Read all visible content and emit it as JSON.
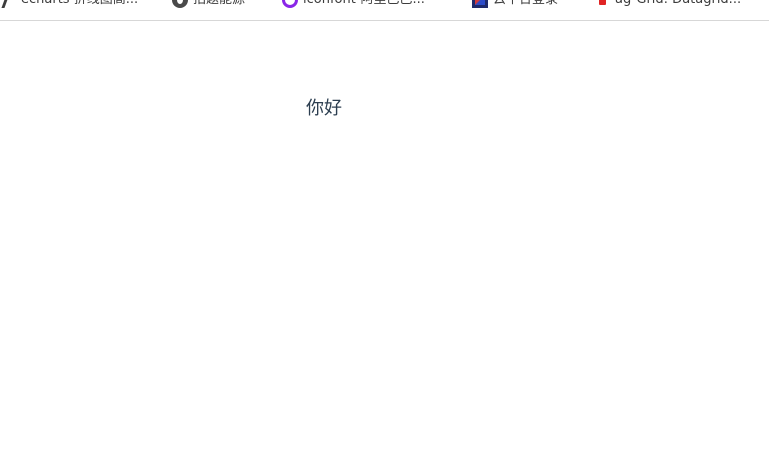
{
  "bookmarks": [
    {
      "label": "echarts 折线图高...",
      "icon": "echarts-icon"
    },
    {
      "label": "拍题能源",
      "icon": "circle-gray-icon"
    },
    {
      "label": "iconfont-阿里巴巴...",
      "icon": "iconfont-icon"
    },
    {
      "label": "云平台登录",
      "icon": "cloud-platform-icon"
    },
    {
      "label": "ag-Grid: Datagrid...",
      "icon": "aggrid-icon"
    }
  ],
  "main": {
    "text": "你好"
  },
  "colors": {
    "text": "#2c3e50",
    "iconfont_purple": "#8a26e8"
  }
}
